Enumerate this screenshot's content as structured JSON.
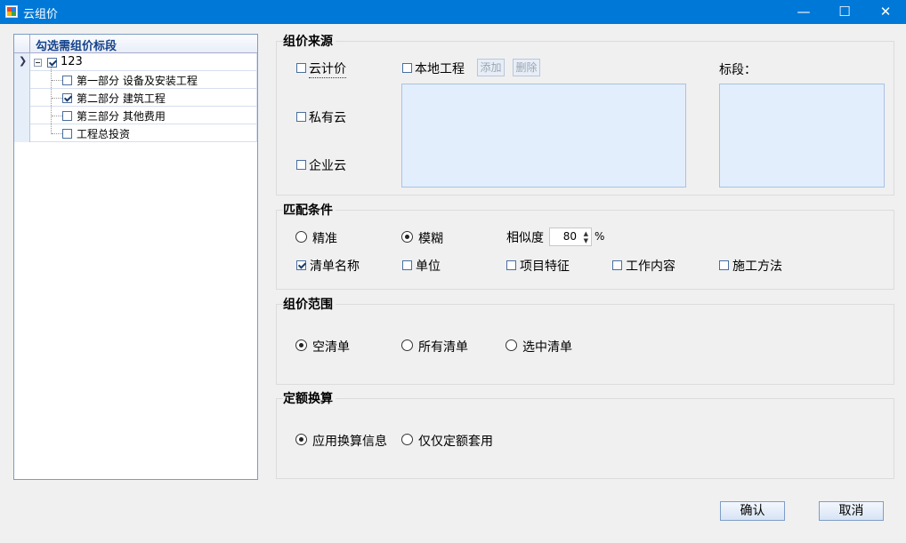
{
  "window": {
    "title": "云组价",
    "minimize": "—",
    "maximize": "☐",
    "close": "✕"
  },
  "tree": {
    "header": "勾选需组价标段",
    "root": {
      "label": "123",
      "checked": true
    },
    "items": [
      {
        "label": "第一部分 设备及安装工程",
        "checked": false
      },
      {
        "label": "第二部分 建筑工程",
        "checked": true
      },
      {
        "label": "第三部分 其他费用",
        "checked": false
      },
      {
        "label": "工程总投资",
        "checked": false
      }
    ]
  },
  "source": {
    "title": "组价来源",
    "options": [
      {
        "label": "云计价",
        "checked": false
      },
      {
        "label": "私有云",
        "checked": false
      },
      {
        "label": "企业云",
        "checked": false
      }
    ],
    "local_project": {
      "label": "本地工程",
      "checked": false
    },
    "add_button": "添加",
    "delete_button": "删除",
    "section_label": "标段："
  },
  "match": {
    "title": "匹配条件",
    "exact": "精准",
    "fuzzy": "模糊",
    "selected_mode": "模糊",
    "similarity_label": "相似度",
    "similarity_value": "80",
    "similarity_unit": "%",
    "fields": [
      {
        "label": "清单名称",
        "checked": true
      },
      {
        "label": "单位",
        "checked": false
      },
      {
        "label": "项目特征",
        "checked": false
      },
      {
        "label": "工作内容",
        "checked": false
      },
      {
        "label": "施工方法",
        "checked": false
      }
    ]
  },
  "scope": {
    "title": "组价范围",
    "options": [
      "空清单",
      "所有清单",
      "选中清单"
    ],
    "selected": "空清单"
  },
  "quota": {
    "title": "定额换算",
    "options": [
      "应用换算信息",
      "仅仅定额套用"
    ],
    "selected": "应用换算信息"
  },
  "buttons": {
    "confirm": "确认",
    "cancel": "取消"
  }
}
